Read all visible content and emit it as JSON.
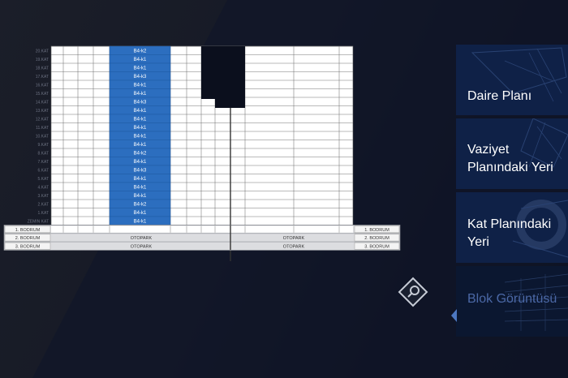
{
  "floors": [
    "20.KAT",
    "19.KAT",
    "18.KAT",
    "17.KAT",
    "16.KAT",
    "15.KAT",
    "14.KAT",
    "13.KAT",
    "12.KAT",
    "11.KAT",
    "10.KAT",
    "9.KAT",
    "8.KAT",
    "7.KAT",
    "6.KAT",
    "5.KAT",
    "4.KAT",
    "3.KAT",
    "2.KAT",
    "1.KAT",
    "ZEMIN KAT"
  ],
  "unit_labels": [
    "B4-k2",
    "B4-k1",
    "B4-k1",
    "B4-k3",
    "B4-k1",
    "B4-k1",
    "B4-k3",
    "B4-k1",
    "B4-k1",
    "B4-k1",
    "B4-k1",
    "B4-k1",
    "B4-k2",
    "B4-k1",
    "B4-k3",
    "B4-k1",
    "B4-k1",
    "B4-k1",
    "B4-k2",
    "B4-k1",
    "B4-k1"
  ],
  "basement": {
    "left_labels": [
      "1. BODRUM",
      "2. BODRUM",
      "3. BODRUM"
    ],
    "right_labels": [
      "1. BODRUM",
      "2. BODRUM",
      "3. BODRUM"
    ],
    "parking_label": "OTOPARK"
  },
  "menu": [
    {
      "label": "Daire Planı"
    },
    {
      "label": "Vaziyet Planındaki Yeri"
    },
    {
      "label": "Kat Planındaki Yeri"
    },
    {
      "label": "Blok Görüntüsü"
    }
  ],
  "colors": {
    "highlight": "#2c6ebf",
    "menu_bg": "#0f2147",
    "menu_active_text": "#4b68a6",
    "accent": "#4d78c2"
  },
  "icons": {
    "zoom": "search-icon",
    "marker": "caret-left-icon"
  }
}
